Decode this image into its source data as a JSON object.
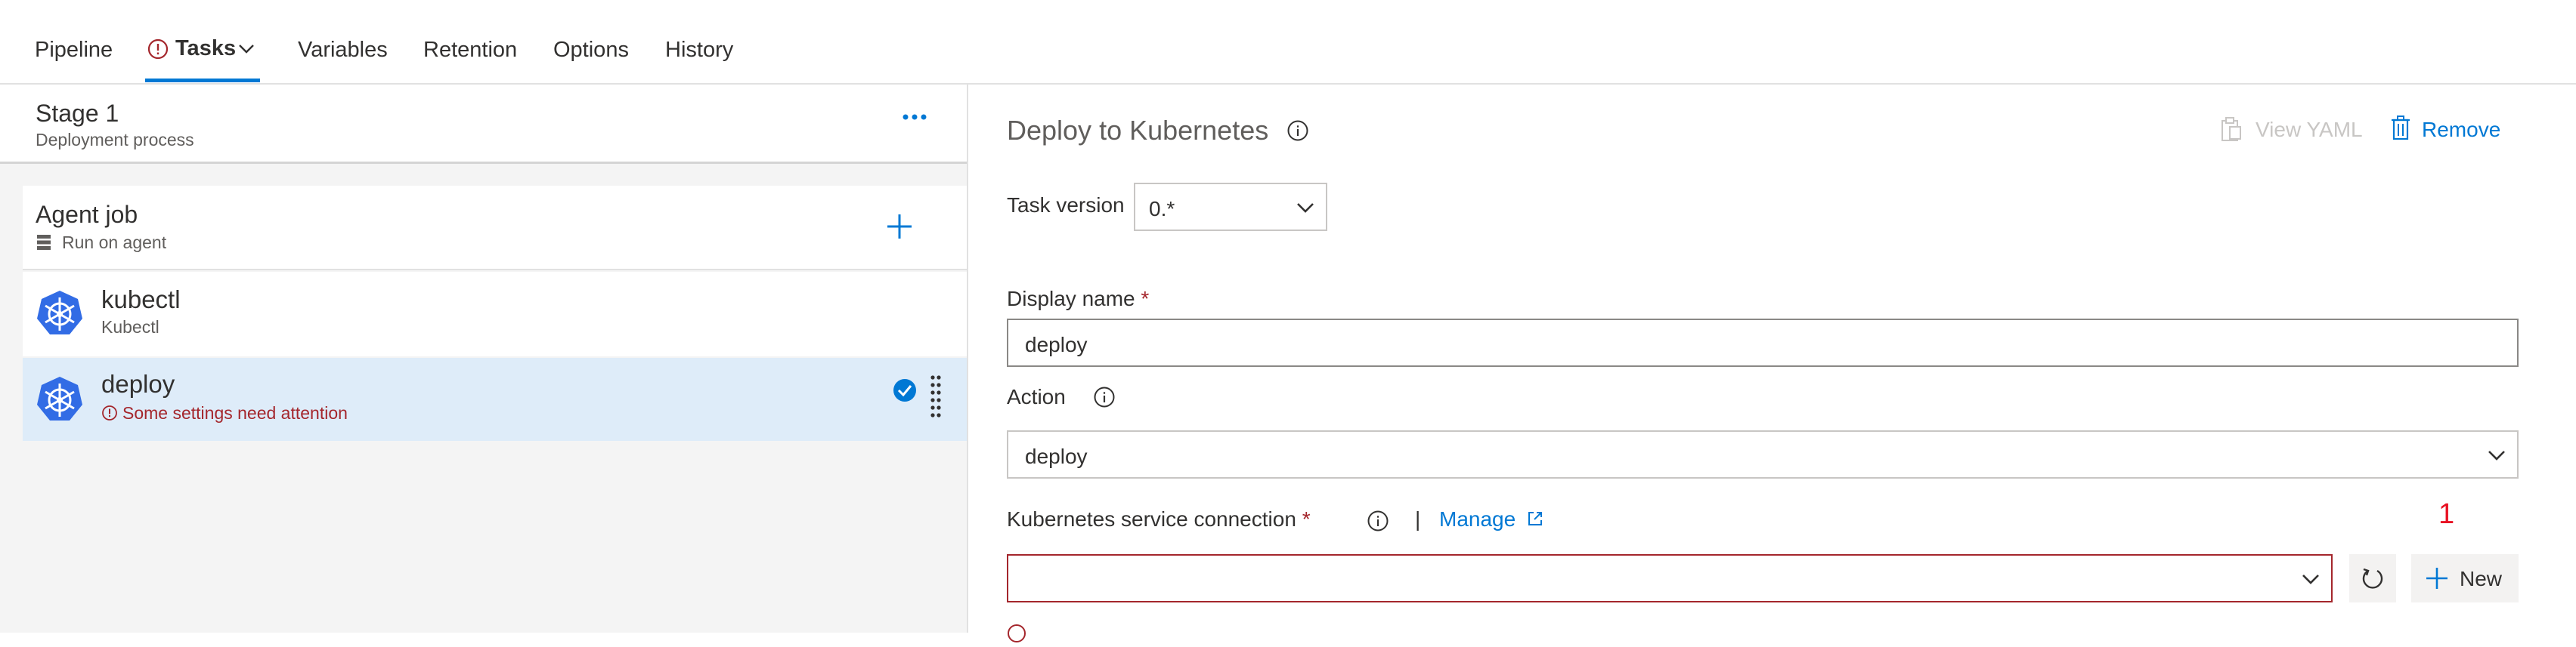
{
  "tabs": {
    "pipeline": "Pipeline",
    "tasks": "Tasks",
    "variables": "Variables",
    "retention": "Retention",
    "options": "Options",
    "history": "History"
  },
  "stage": {
    "title": "Stage 1",
    "subtitle": "Deployment process",
    "more": "···"
  },
  "agent_job": {
    "title": "Agent job",
    "subtitle": "Run on agent"
  },
  "tasks_list": [
    {
      "name": "kubectl",
      "subtitle": "Kubectl"
    },
    {
      "name": "deploy",
      "subtitle": "Some settings need attention"
    }
  ],
  "detail": {
    "title": "Deploy to Kubernetes",
    "view_yaml": "View YAML",
    "remove": "Remove",
    "task_version_label": "Task version",
    "task_version_value": "0.*",
    "display_name_label": "Display name",
    "required_mark": "*",
    "display_name_value": "deploy",
    "action_label": "Action",
    "action_value": "deploy",
    "k8s_conn_label": "Kubernetes service connection",
    "separator": "|",
    "manage": "Manage",
    "k8s_conn_value": "",
    "new_button": "New",
    "badge_number": "1"
  },
  "colors": {
    "accent": "#0078d4",
    "error": "#a4262c",
    "selected_row": "#deecf9",
    "badge_red": "#e81123"
  }
}
